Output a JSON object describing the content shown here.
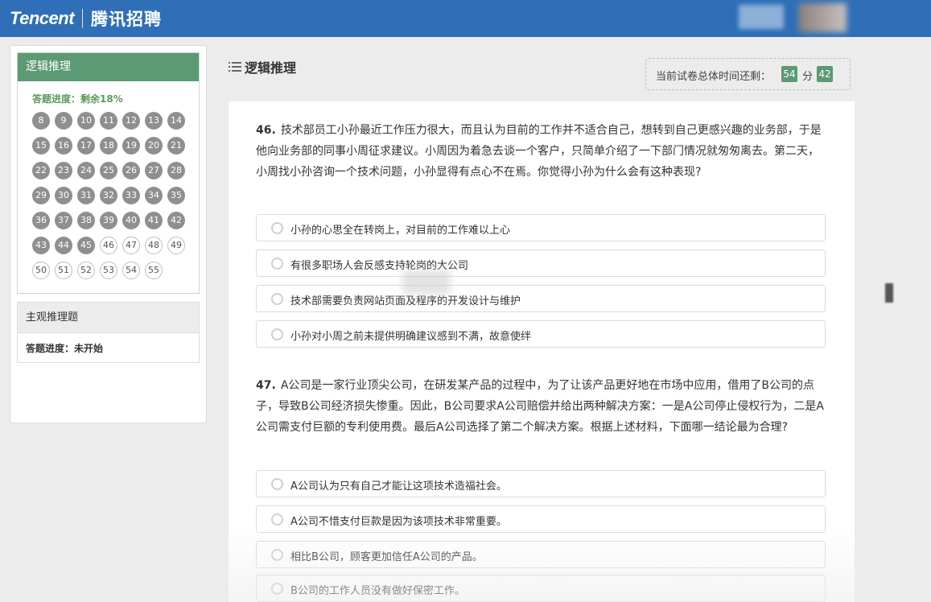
{
  "header": {
    "brand_en": "Tencent",
    "brand_cn": "腾讯招聘",
    "bg_color": "#2e6fb8"
  },
  "sidebar": {
    "sections": [
      {
        "title": "逻辑推理",
        "progress": "答题进度：剩余18%",
        "numbers": [
          "8",
          "9",
          "10",
          "11",
          "12",
          "13",
          "14",
          "15",
          "16",
          "17",
          "18",
          "19",
          "20",
          "21",
          "22",
          "23",
          "24",
          "25",
          "26",
          "27",
          "28",
          "29",
          "30",
          "31",
          "32",
          "33",
          "34",
          "35",
          "36",
          "37",
          "38",
          "39",
          "40",
          "41",
          "42",
          "43",
          "44",
          "45",
          "46",
          "47",
          "48",
          "49",
          "50",
          "51",
          "52",
          "53",
          "54",
          "55"
        ],
        "answered_through": "45",
        "accent": "#5c9a73"
      },
      {
        "title": "主观推理题",
        "progress": "答题进度：未开始"
      }
    ]
  },
  "main": {
    "title": "逻辑推理",
    "title_icon": "list-icon",
    "timer": {
      "label": "当前试卷总体时间还剩：",
      "minutes": "54",
      "minutes_unit": "分",
      "seconds": "42"
    },
    "questions": [
      {
        "number": "46.",
        "text": "技术部员工小孙最近工作压力很大，而且认为目前的工作并不适合自己，想转到自己更感兴趣的业务部，于是他向业务部的同事小周征求建议。小周因为着急去谈一个客户，只简单介绍了一下部门情况就匆匆离去。第二天，小周找小孙咨询一个技术问题，小孙显得有点心不在焉。你觉得小孙为什么会有这种表现?",
        "options": [
          "小孙的心思全在转岗上，对目前的工作难以上心",
          "有很多职场人会反感支持轮岗的大公司",
          "技术部需要负责网站页面及程序的开发设计与维护",
          "小孙对小周之前未提供明确建议感到不满，故意使绊"
        ]
      },
      {
        "number": "47.",
        "text": "A公司是一家行业顶尖公司，在研发某产品的过程中，为了让该产品更好地在市场中应用，借用了B公司的点子，导致B公司经济损失惨重。因此，B公司要求A公司赔偿并给出两种解决方案：一是A公司停止侵权行为，二是A公司需支付巨额的专利使用费。最后A公司选择了第二个解决方案。根据上述材料，下面哪一结论最为合理?",
        "options": [
          "A公司认为只有自己才能让这项技术造福社会。",
          "A公司不惜支付巨款是因为该项技术非常重要。",
          "相比B公司，顾客更加信任A公司的产品。",
          "B公司的工作人员没有做好保密工作。"
        ]
      }
    ]
  }
}
